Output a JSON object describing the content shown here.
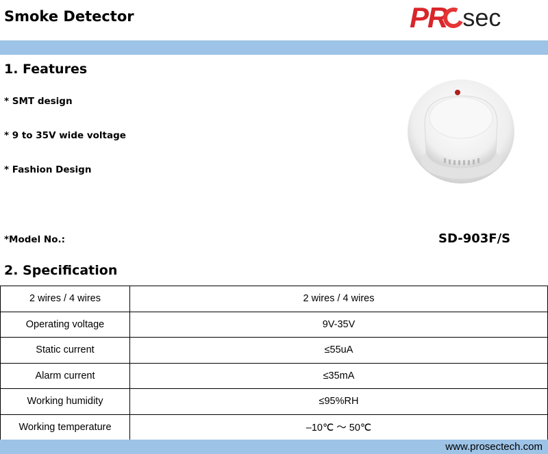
{
  "header": {
    "title": "Smoke Detector",
    "logo": {
      "pro": "PR",
      "sec": "sec",
      "text": "PROsec"
    }
  },
  "features": {
    "heading": "1. Features",
    "items": [
      "* SMT design",
      "* 9 to 35V wide voltage",
      "* Fashion Design"
    ]
  },
  "model": {
    "label": "*Model No.:",
    "value": "SD-903F/S"
  },
  "specification": {
    "heading": "2. Specification",
    "rows": [
      [
        "2 wires / 4 wires",
        "2 wires / 4 wires"
      ],
      [
        "Operating voltage",
        "9V-35V"
      ],
      [
        "Static current",
        "≤55uA"
      ],
      [
        "Alarm current",
        "≤35mA"
      ],
      [
        "Working humidity",
        "≤95%RH"
      ],
      [
        "Working temperature",
        "–10℃ ～ 50℃"
      ]
    ]
  },
  "footer": {
    "url": "www.prosectech.com"
  },
  "colors": {
    "band": "#9dc3e6",
    "brand_red": "#d8262b"
  }
}
